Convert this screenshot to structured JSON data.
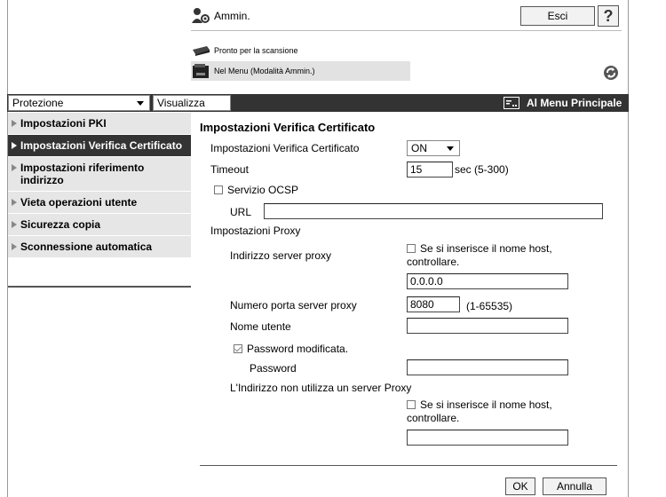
{
  "header": {
    "admin_label": "Ammin.",
    "logout_label": "Esci",
    "help_label": "?",
    "status_text": "Pronto per la scansione",
    "mode_text": "Nel Menu (Modalità Ammin.)"
  },
  "navbar": {
    "category_value": "Protezione",
    "view_label": "Visualizza",
    "main_menu_label": "Al Menu Principale"
  },
  "sidebar": {
    "items": [
      {
        "label": "Impostazioni PKI"
      },
      {
        "label": "Impostazioni Verifica Certificato"
      },
      {
        "label": "Impostazioni riferimento indirizzo"
      },
      {
        "label": "Vieta operazioni utente"
      },
      {
        "label": "Sicurezza copia"
      },
      {
        "label": "Sconnessione automatica"
      }
    ]
  },
  "form": {
    "title": "Impostazioni Verifica Certificato",
    "verify_label": "Impostazioni Verifica Certificato",
    "verify_value": "ON",
    "timeout_label": "Timeout",
    "timeout_value": "15",
    "timeout_unit": "sec (5-300)",
    "ocsp_label": "Servizio OCSP",
    "url_label": "URL",
    "url_value": "",
    "proxy_section": "Impostazioni Proxy",
    "proxy_address_label": "Indirizzo server proxy",
    "proxy_hostname_check": "Se si inserisce il nome host, controllare.",
    "proxy_address_value": "0.0.0.0",
    "proxy_port_label": "Numero porta server proxy",
    "proxy_port_value": "8080",
    "proxy_port_range": "(1-65535)",
    "username_label": "Nome utente",
    "username_value": "",
    "password_changed_label": "Password modificata.",
    "password_label": "Password",
    "password_value": "",
    "no_proxy_label": "L'Indirizzo non utilizza un server Proxy",
    "no_proxy_hostname_check": "Se si inserisce il nome host, controllare.",
    "no_proxy_value": ""
  },
  "actions": {
    "ok_label": "OK",
    "cancel_label": "Annulla"
  }
}
